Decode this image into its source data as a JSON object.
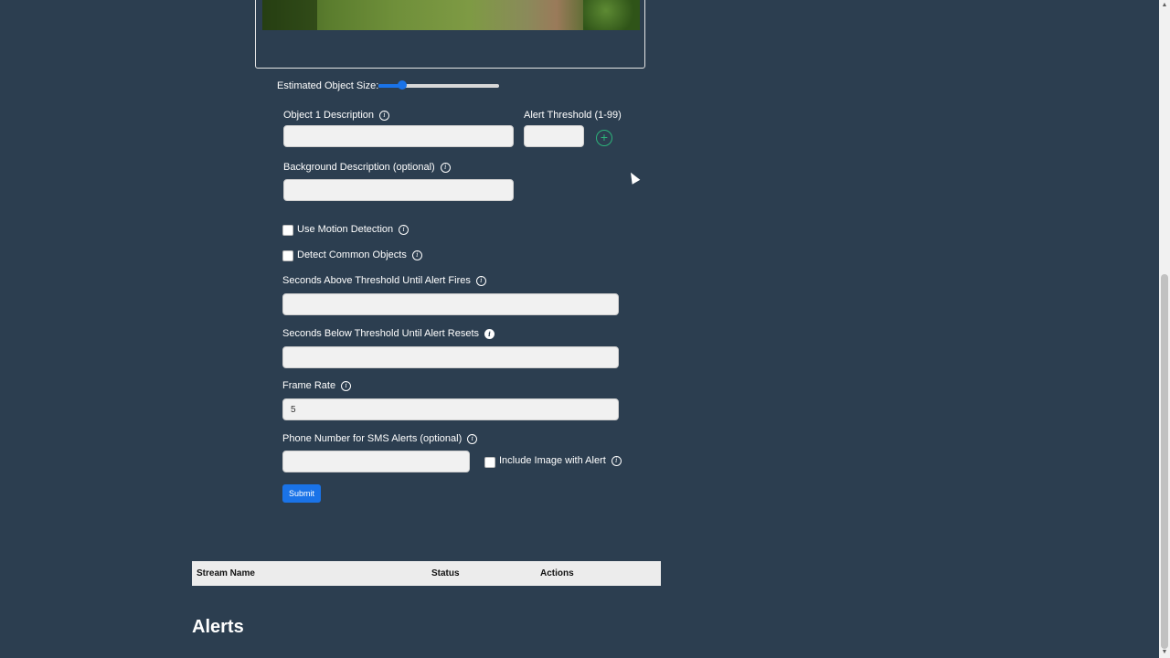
{
  "form": {
    "object_size_label": "Estimated Object Size:",
    "object_size_value": 0.2,
    "object_description_label": "Object 1 Description",
    "object_description_value": "",
    "alert_threshold_label": "Alert Threshold (1-99)",
    "alert_threshold_value": "",
    "background_description_label": "Background Description (optional)",
    "background_description_value": "",
    "motion_detection_label": "Use Motion Detection",
    "common_objects_label": "Detect Common Objects",
    "seconds_above_label": "Seconds Above Threshold Until Alert Fires",
    "seconds_above_value": "",
    "seconds_below_label": "Seconds Below Threshold Until Alert Resets",
    "seconds_below_value": "",
    "frame_rate_label": "Frame Rate",
    "frame_rate_value": "5",
    "phone_label": "Phone Number for SMS Alerts (optional)",
    "phone_value": "",
    "include_image_label": "Include Image with Alert",
    "submit_label": "Submit"
  },
  "stream_table": {
    "columns": [
      "Stream Name",
      "Status",
      "Actions"
    ]
  },
  "alerts": {
    "heading": "Alerts"
  },
  "icons": {
    "info": "i",
    "add": "+"
  },
  "colors": {
    "background": "#2c3e50",
    "accent": "#1a73e8",
    "add_icon": "#2db37a"
  }
}
